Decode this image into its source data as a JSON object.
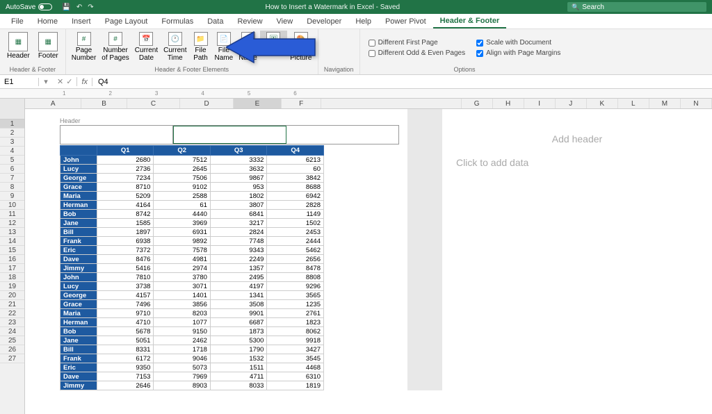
{
  "title": {
    "autosave": "AutoSave",
    "doc": "How to Insert a Watermark in Excel - Saved",
    "search": "Search"
  },
  "tabs": [
    "File",
    "Home",
    "Insert",
    "Page Layout",
    "Formulas",
    "Data",
    "Review",
    "View",
    "Developer",
    "Help",
    "Power Pivot",
    "Header & Footer"
  ],
  "active_tab": 11,
  "ribbon": {
    "g1": {
      "items": [
        "Header",
        "Footer"
      ],
      "label": "Header & Footer"
    },
    "g2": {
      "items": [
        "Page Number",
        "Number of Pages",
        "Current Date",
        "Current Time",
        "File Path",
        "File Name",
        "Sheet Name",
        "Picture",
        "Format Picture"
      ],
      "label": "Header & Footer Elements"
    },
    "g3": {
      "label": "Navigation"
    },
    "g4": {
      "c1": "Different First Page",
      "c2": "Different Odd & Even Pages",
      "c3": "Scale with Document",
      "c4": "Align with Page Margins",
      "label": "Options"
    }
  },
  "namebox": "E1",
  "formula": "Q4",
  "ruler": [
    "1",
    "2",
    "3",
    "4",
    "5",
    "6"
  ],
  "cols_left": [
    "A",
    "B",
    "C",
    "D",
    "E",
    "F"
  ],
  "cols_right": [
    "G",
    "H",
    "I",
    "J",
    "K",
    "L",
    "M",
    "N"
  ],
  "header_label": "Header",
  "add_header": "Add header",
  "add_data": "Click to add data",
  "table": {
    "headers": [
      "",
      "Q1",
      "Q2",
      "Q3",
      "Q4"
    ],
    "rows": [
      [
        "John",
        2680,
        7512,
        3332,
        6213
      ],
      [
        "Lucy",
        2736,
        2645,
        3632,
        60
      ],
      [
        "George",
        7234,
        7506,
        9867,
        3842
      ],
      [
        "Grace",
        8710,
        9102,
        953,
        8688
      ],
      [
        "Maria",
        5209,
        2588,
        1802,
        6942
      ],
      [
        "Herman",
        4164,
        61,
        3807,
        2828
      ],
      [
        "Bob",
        8742,
        4440,
        6841,
        1149
      ],
      [
        "Jane",
        1585,
        3969,
        3217,
        1502
      ],
      [
        "Bill",
        1897,
        6931,
        2824,
        2453
      ],
      [
        "Frank",
        6938,
        9892,
        7748,
        2444
      ],
      [
        "Eric",
        7372,
        7578,
        9343,
        5462
      ],
      [
        "Dave",
        8476,
        4981,
        2249,
        2656
      ],
      [
        "Jimmy",
        5416,
        2974,
        1357,
        8478
      ],
      [
        "John",
        7810,
        3780,
        2495,
        8808
      ],
      [
        "Lucy",
        3738,
        3071,
        4197,
        9296
      ],
      [
        "George",
        4157,
        1401,
        1341,
        3565
      ],
      [
        "Grace",
        7496,
        3856,
        3508,
        1235
      ],
      [
        "Maria",
        9710,
        8203,
        9901,
        2761
      ],
      [
        "Herman",
        4710,
        1077,
        6687,
        1823
      ],
      [
        "Bob",
        5678,
        9150,
        1873,
        8062
      ],
      [
        "Jane",
        5051,
        2462,
        5300,
        9918
      ],
      [
        "Bill",
        8331,
        1718,
        1790,
        3427
      ],
      [
        "Frank",
        6172,
        9046,
        1532,
        3545
      ],
      [
        "Eric",
        9350,
        5073,
        1511,
        4468
      ],
      [
        "Dave",
        7153,
        7969,
        4711,
        6310
      ],
      [
        "Jimmy",
        2646,
        8903,
        8033,
        1819
      ]
    ]
  }
}
